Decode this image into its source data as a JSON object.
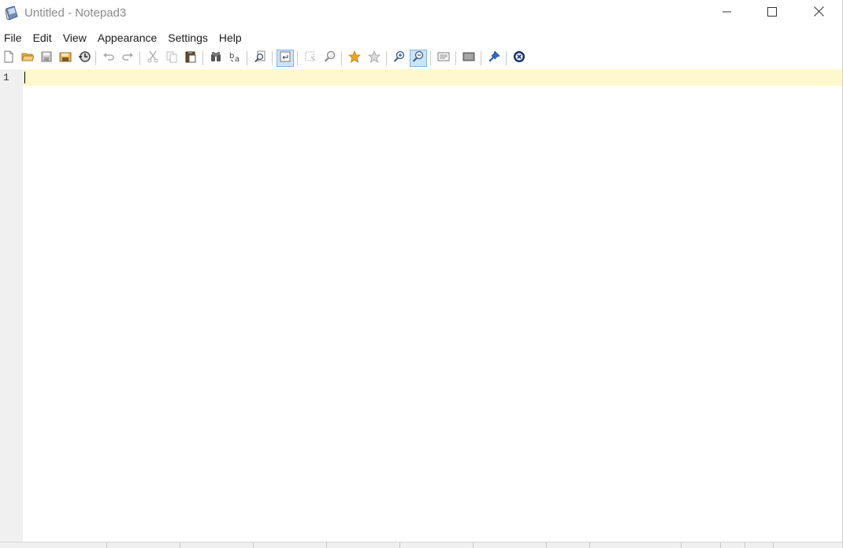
{
  "window": {
    "title": "Untitled - Notepad3",
    "controls": {
      "minimize_icon": "minimize-icon",
      "maximize_icon": "maximize-icon",
      "close_icon": "close-icon"
    }
  },
  "menu": {
    "items": [
      "File",
      "Edit",
      "View",
      "Appearance",
      "Settings",
      "Help"
    ]
  },
  "toolbar": {
    "buttons": [
      {
        "name": "new-file",
        "icon": "new-file-icon"
      },
      {
        "name": "open-file",
        "icon": "open-folder-icon"
      },
      {
        "name": "save-file",
        "icon": "save-icon"
      },
      {
        "name": "save-as",
        "icon": "save-as-icon"
      },
      {
        "name": "browse",
        "icon": "browse-icon"
      },
      {
        "name": "undo",
        "icon": "undo-icon"
      },
      {
        "name": "redo",
        "icon": "redo-icon"
      },
      {
        "name": "cut",
        "icon": "cut-icon"
      },
      {
        "name": "copy",
        "icon": "copy-icon"
      },
      {
        "name": "paste",
        "icon": "paste-icon"
      },
      {
        "name": "find",
        "icon": "find-icon"
      },
      {
        "name": "replace",
        "icon": "replace-icon"
      },
      {
        "name": "find-in-files",
        "icon": "find-in-files-icon"
      },
      {
        "name": "word-wrap",
        "icon": "word-wrap-icon",
        "pressed": true
      },
      {
        "name": "select-all",
        "icon": "select-icon"
      },
      {
        "name": "zoom-find",
        "icon": "magnifier-icon"
      },
      {
        "name": "add-favorite",
        "icon": "star-icon"
      },
      {
        "name": "manage-favorites",
        "icon": "star-outline-icon"
      },
      {
        "name": "zoom-in",
        "icon": "zoom-in-icon"
      },
      {
        "name": "zoom-out",
        "icon": "zoom-out-icon",
        "pressed": true
      },
      {
        "name": "schemes",
        "icon": "schemes-icon"
      },
      {
        "name": "customize",
        "icon": "screen-icon"
      },
      {
        "name": "always-on-top",
        "icon": "pin-icon"
      },
      {
        "name": "exit",
        "icon": "exit-icon"
      }
    ]
  },
  "editor": {
    "line_numbers": [
      "1"
    ],
    "content": "",
    "current_line_color": "#fff8cc",
    "gutter_color": "#f0f0f0"
  },
  "colors": {
    "title_text": "#8a8a8a",
    "pressed_bg": "#cce4f7",
    "pressed_border": "#7eb4ea",
    "star": "#f0a818"
  }
}
